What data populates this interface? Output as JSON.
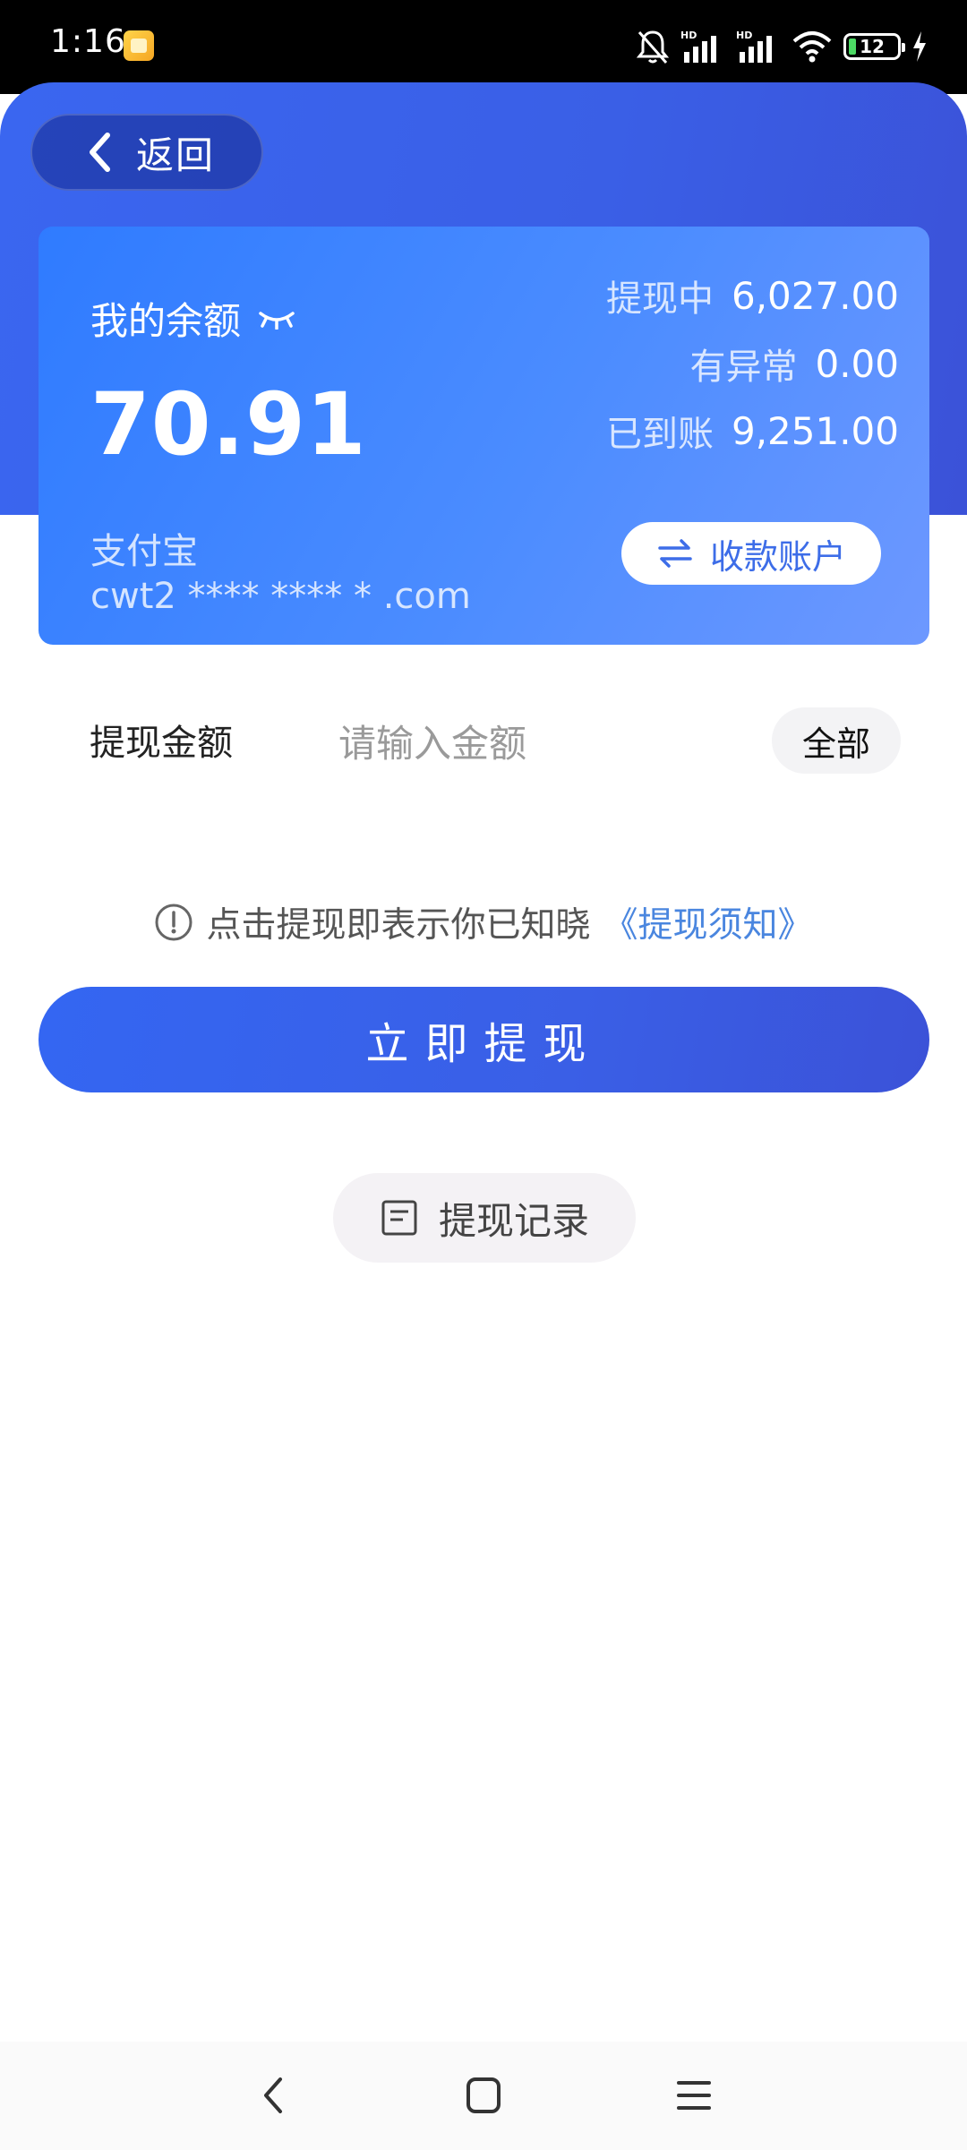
{
  "status_bar": {
    "time": "1:16",
    "battery_level": "12",
    "icons": [
      "app-notification-icon",
      "mute-icon",
      "hd-signal-icon",
      "hd-signal-icon",
      "wifi-icon",
      "battery-icon",
      "charging-icon"
    ]
  },
  "header": {
    "back_label": "返回"
  },
  "balance_card": {
    "label": "我的余额",
    "amount": "70.91",
    "stats": [
      {
        "label": "提现中",
        "value": "6,027.00"
      },
      {
        "label": "有异常",
        "value": "0.00"
      },
      {
        "label": "已到账",
        "value": "9,251.00"
      }
    ],
    "payment_method": "支付宝",
    "account": "cwt2 **** **** * .com",
    "account_button_label": "收款账户"
  },
  "withdraw_form": {
    "amount_label": "提现金额",
    "amount_value": "",
    "amount_placeholder": "请输入金额",
    "all_button_label": "全部",
    "notice_text": "点击提现即表示你已知晓",
    "notice_link": "《提现须知》",
    "submit_label": "立即提现",
    "history_label": "提现记录"
  },
  "colors": {
    "brand_blue": "#3a5fe6",
    "card_blue": "#2f7bff",
    "link_blue": "#4a86df"
  }
}
